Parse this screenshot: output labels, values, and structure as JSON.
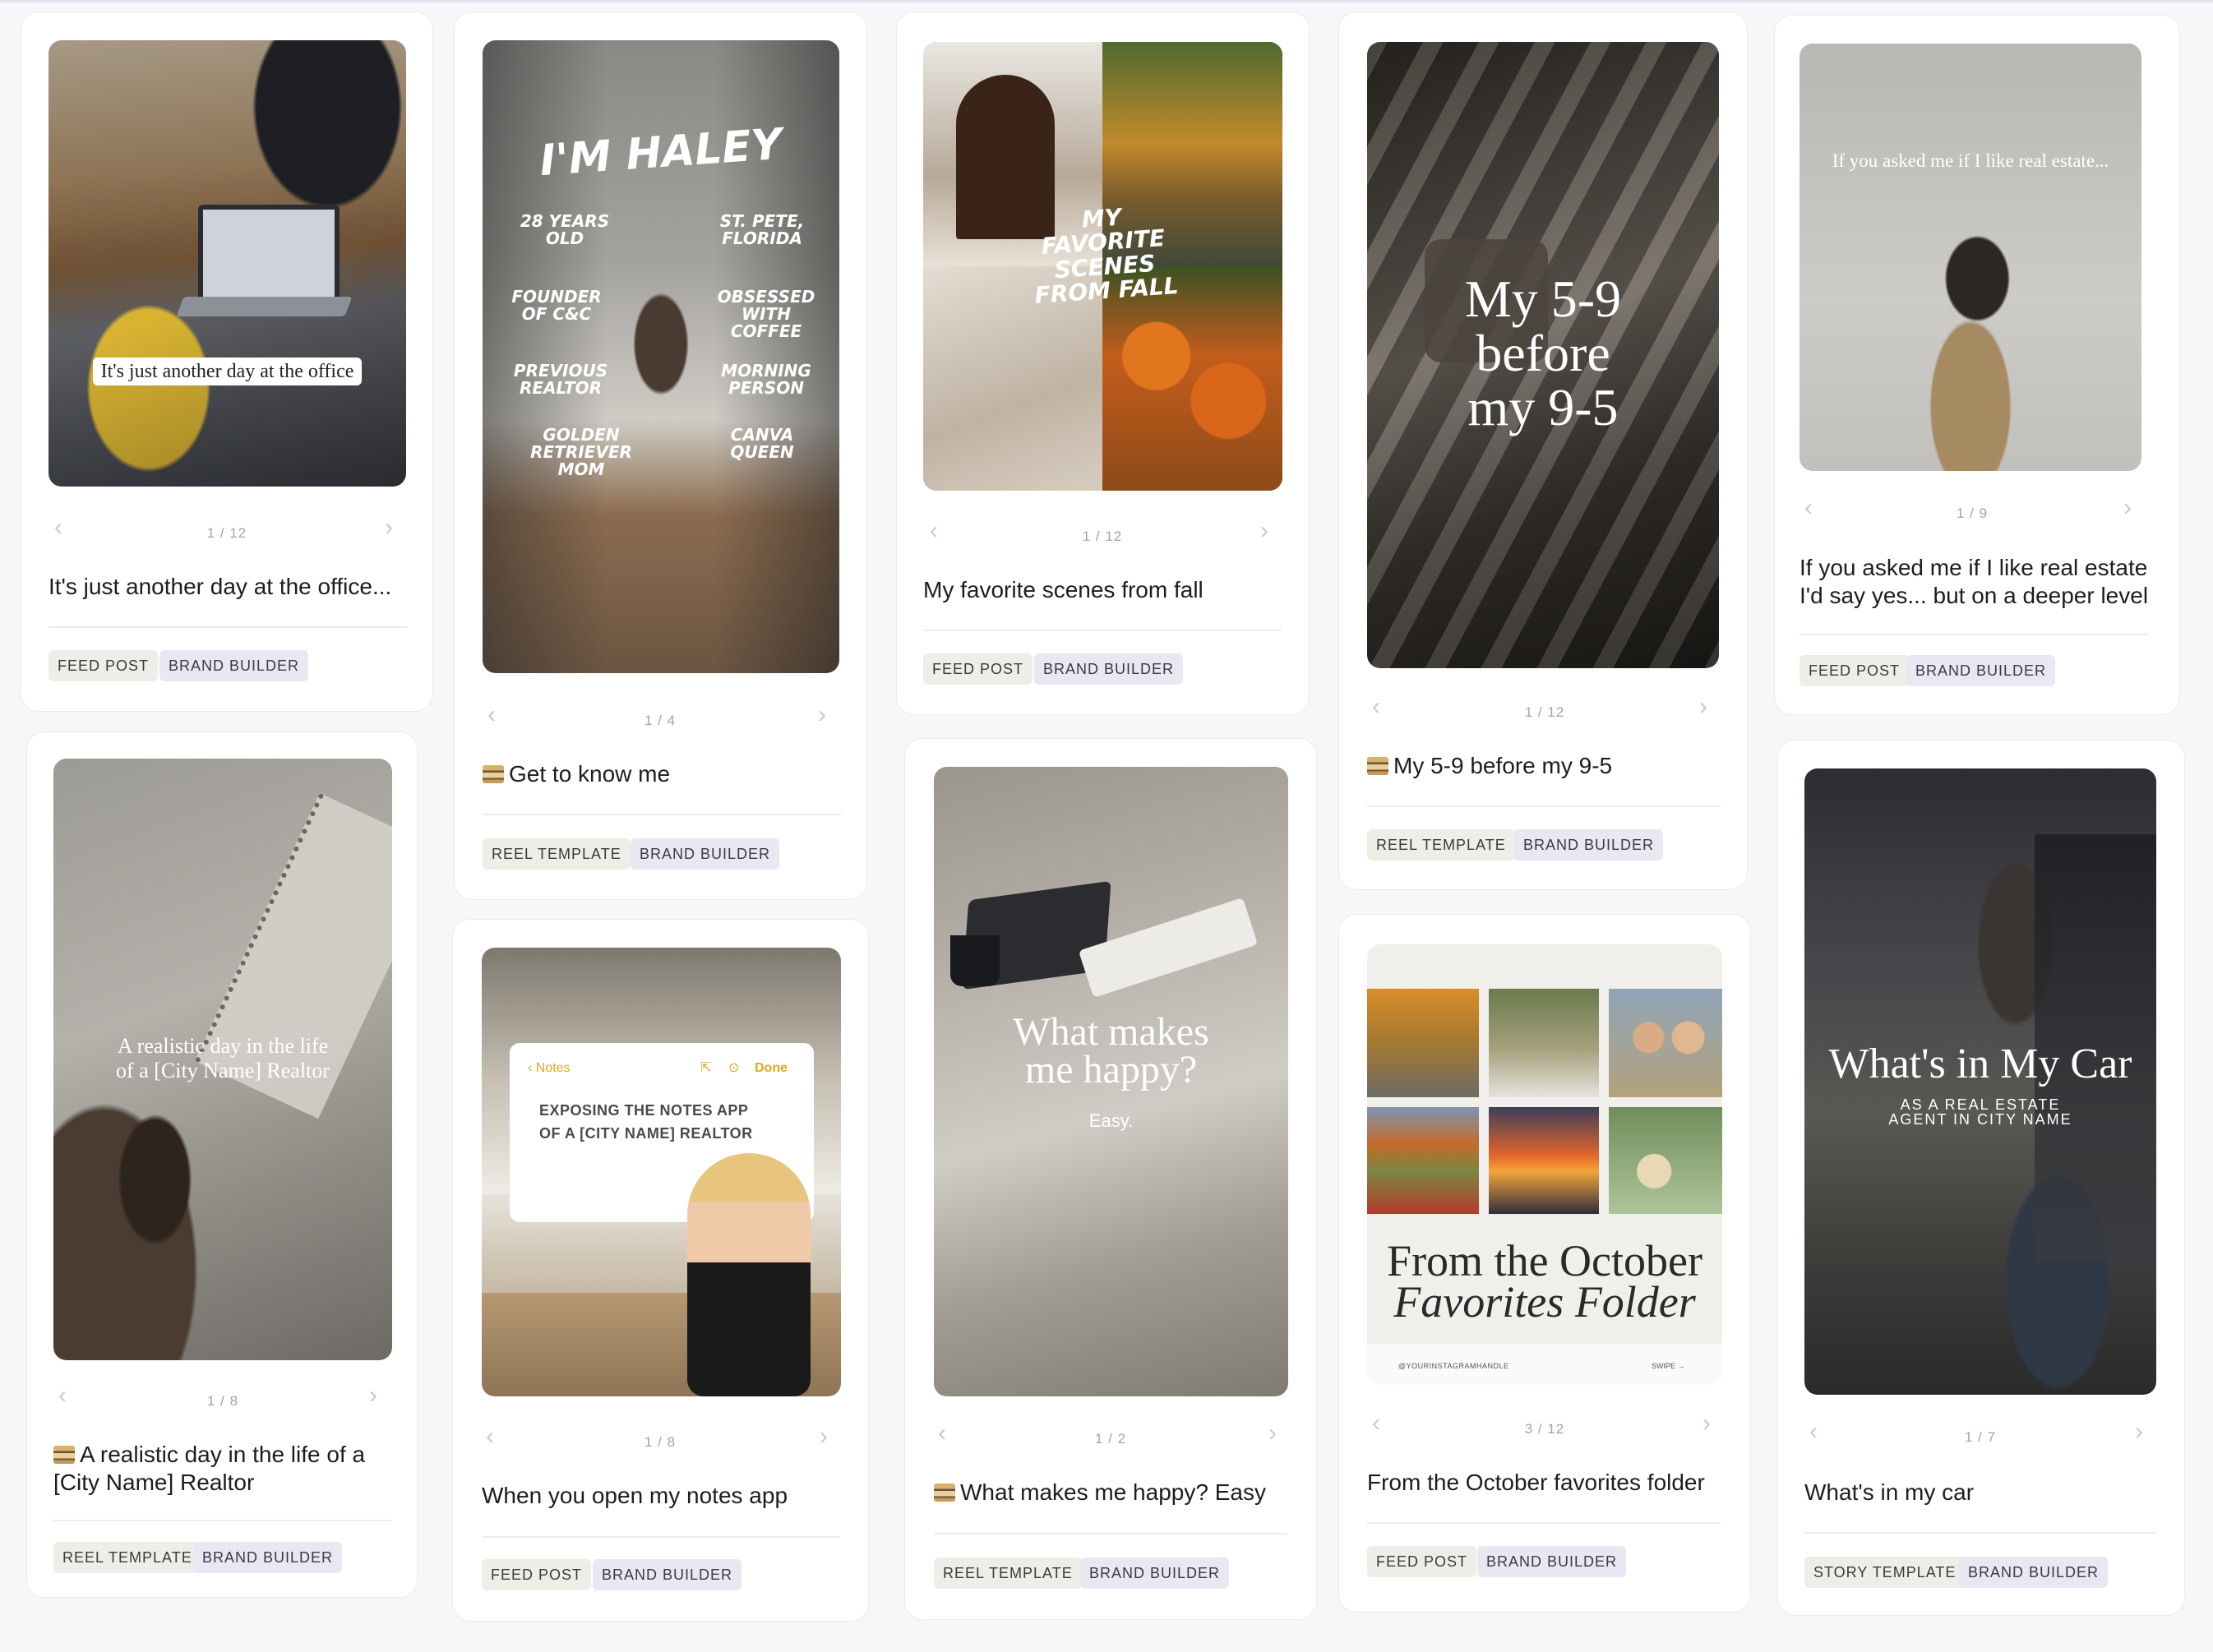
{
  "cards": {
    "c1": {
      "overlay": "It's just another day at the office",
      "pager": "1 / 12",
      "title": "It's just another day at the office...",
      "tags": [
        "FEED POST",
        "BRAND BUILDER"
      ]
    },
    "c2": {
      "overlay_title": "I'M HALEY",
      "facts": [
        "28 YEARS OLD",
        "ST. PETE, FLORIDA",
        "FOUNDER OF C&C",
        "OBSESSED WITH COFFEE",
        "PREVIOUS REALTOR",
        "MORNING PERSON",
        "GOLDEN RETRIEVER MOM",
        "CANVA QUEEN"
      ],
      "pager": "1 / 4",
      "title": "Get to know me",
      "tags": [
        "REEL TEMPLATE",
        "BRAND BUILDER"
      ]
    },
    "c3": {
      "overlay": "MY FAVORITE SCENES FROM FALL",
      "pager": "1 / 12",
      "title": "My favorite scenes from fall",
      "tags": [
        "FEED POST",
        "BRAND BUILDER"
      ]
    },
    "c4": {
      "overlay": "My 5-9 before my 9-5",
      "pager": "1 / 12",
      "title": "My 5-9 before my 9-5",
      "tags": [
        "REEL TEMPLATE",
        "BRAND BUILDER"
      ]
    },
    "c5": {
      "overlay": "If you asked me if I like real estate...",
      "pager": "1 / 9",
      "title": "If you asked me if I like real estate I'd say yes... but on a deeper level",
      "tags": [
        "FEED POST",
        "BRAND BUILDER"
      ]
    },
    "c6": {
      "overlay": "A realistic day in the life of a [City Name] Realtor",
      "pager": "1 / 8",
      "title": "A realistic day in the life of a [City Name] Realtor",
      "tags": [
        "REEL TEMPLATE",
        "BRAND BUILDER"
      ]
    },
    "c7": {
      "notes_back": "Notes",
      "notes_done": "Done",
      "notes_text": "EXPOSING THE NOTES APP OF A [CITY NAME] REALTOR",
      "pager": "1 / 8",
      "title": "When you open my notes app",
      "tags": [
        "FEED POST",
        "BRAND BUILDER"
      ]
    },
    "c8": {
      "overlay": "What makes me happy?",
      "overlay_sub": "Easy.",
      "pager": "1 / 2",
      "title": "What makes me happy? Easy",
      "tags": [
        "REEL TEMPLATE",
        "BRAND BUILDER"
      ]
    },
    "c9": {
      "overlay_line1": "From the October",
      "overlay_line2": "Favorites Folder",
      "handle": "@YOURINSTAGRAMHANDLE",
      "swipe": "SWIPE →",
      "pager": "3 / 12",
      "title": "From the October favorites folder",
      "tags": [
        "FEED POST",
        "BRAND BUILDER"
      ]
    },
    "c10": {
      "overlay": "What's in My Car",
      "overlay_sub": "AS A REAL ESTATE AGENT IN CITY NAME",
      "pager": "1 / 7",
      "title": "What's in my car",
      "tags": [
        "STORY TEMPLATE",
        "BRAND BUILDER"
      ]
    }
  },
  "nav": {
    "prev": "‹",
    "next": "›"
  }
}
